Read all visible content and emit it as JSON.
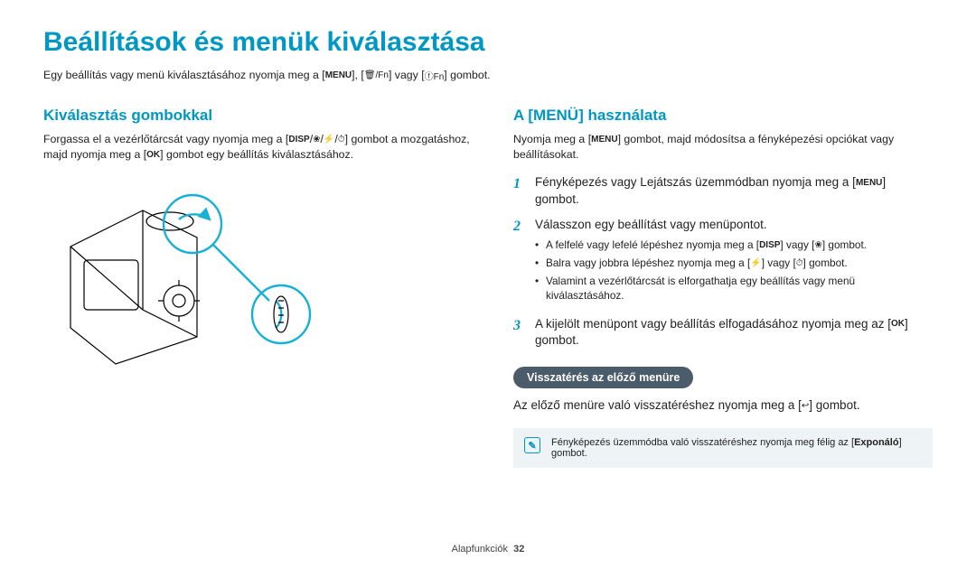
{
  "title": "Beállítások és menük kiválasztása",
  "intro": {
    "pre": "Egy beállítás vagy menü kiválasztásához nyomja meg a [",
    "mid1": "], [",
    "mid2": "] vagy [",
    "post": "] gombot."
  },
  "icons": {
    "menu": "MENU",
    "trash_fn": "🗑/Fn",
    "fn_circle": "ⓕFn",
    "disp": "DISP",
    "macro": "❀",
    "flash": "⚡",
    "timer": "⏱",
    "ok": "OK",
    "back": "↩",
    "note": "✎"
  },
  "left": {
    "heading": "Kiválasztás gombokkal",
    "body_parts": {
      "p1": "Forgassa el a vezérlőtárcsát vagy nyomja meg a [",
      "p2": "] gombot a mozgatáshoz, majd nyomja meg a [",
      "p3": "] gombot egy beállítás kiválasztásához."
    }
  },
  "right": {
    "heading": "A [MENÜ] használata",
    "body_parts": {
      "p1": "Nyomja meg a [",
      "p2": "] gombot, majd módosítsa a fényképezési opciókat vagy beállításokat."
    },
    "steps": [
      {
        "num": "1",
        "parts": {
          "p1": "Fényképezés vagy Lejátszás üzemmódban nyomja meg a [",
          "p2": "] gombot."
        }
      },
      {
        "num": "2",
        "text": "Válasszon egy beállítást vagy menüpontot.",
        "bullets": [
          {
            "p1": "A felfelé vagy lefelé lépéshez nyomja meg a [",
            "p2": "] vagy [",
            "p3": "] gombot."
          },
          {
            "p1": "Balra vagy jobbra lépéshez nyomja meg a [",
            "p2": "] vagy [",
            "p3": "] gombot."
          },
          {
            "text": "Valamint a vezérlőtárcsát is elforgathatja egy beállítás vagy menü kiválasztásához."
          }
        ]
      },
      {
        "num": "3",
        "parts": {
          "p1": "A kijelölt menüpont vagy beállítás elfogadásához nyomja meg az [",
          "p2": "] gombot."
        }
      }
    ],
    "back_heading": "Visszatérés az előző menüre",
    "back_parts": {
      "p1": "Az előző menüre való visszatéréshez nyomja meg a [",
      "p2": "] gombot."
    },
    "note_parts": {
      "p1": "Fényképezés üzemmódba való visszatéréshez nyomja meg félig az [",
      "bold": "Exponáló",
      "p2": "] gombot."
    }
  },
  "footer": {
    "label": "Alapfunkciók",
    "page": "32"
  }
}
